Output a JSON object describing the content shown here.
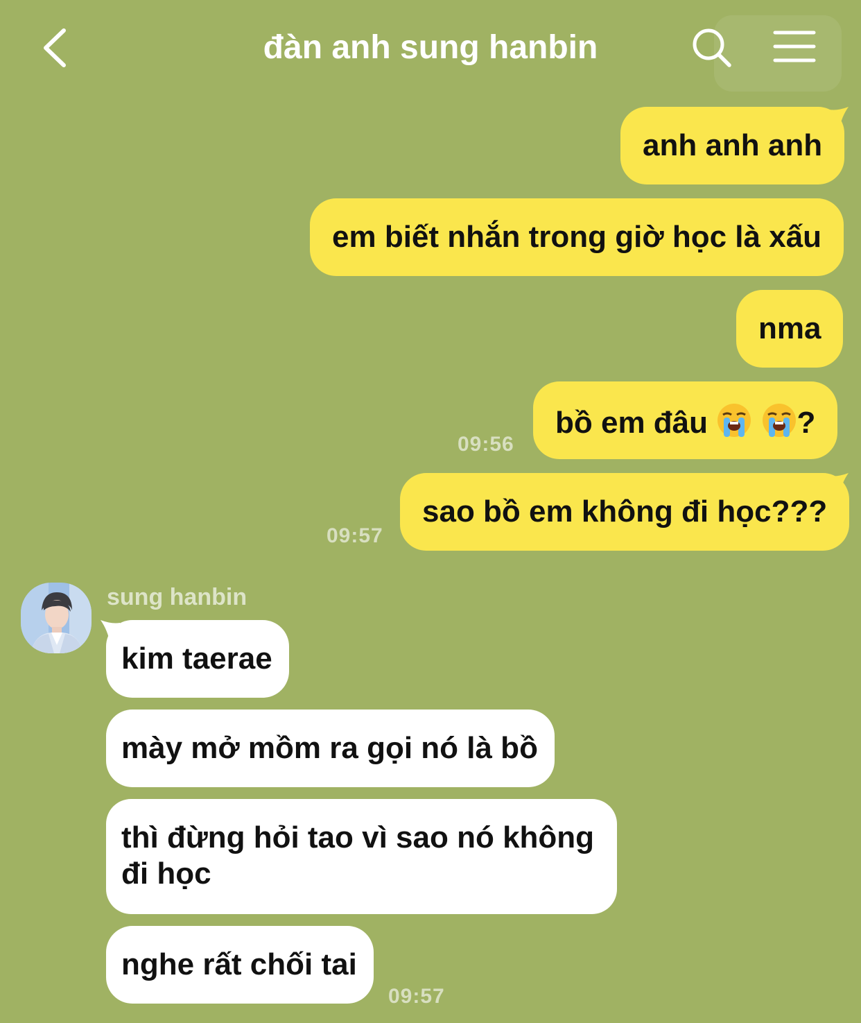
{
  "header": {
    "title": "đàn anh sung hanbin",
    "back_icon": "chevron-left-icon",
    "search_icon": "search-icon",
    "menu_icon": "hamburger-menu-icon"
  },
  "colors": {
    "background": "#a0b263",
    "outgoing_bubble": "#fae64d",
    "incoming_bubble": "#ffffff"
  },
  "messages_out": [
    {
      "text": "anh anh anh"
    },
    {
      "text": "em biết nhắn trong giờ học là xấu"
    },
    {
      "text": "nma"
    },
    {
      "text_before": "bồ em đâu",
      "emoji": "loudly-crying-face",
      "text_after": "?",
      "time": "09:56"
    },
    {
      "text": "sao bồ em không đi học???",
      "time": "09:57"
    }
  ],
  "incoming": {
    "sender": "sung hanbin",
    "avatar": "avatar",
    "messages": [
      {
        "text": "kim taerae"
      },
      {
        "text": "mày mở mồm ra gọi nó là bồ"
      },
      {
        "line1": "thì đừng hỏi tao vì sao nó không",
        "line2": "đi học"
      },
      {
        "text": "nghe rất chối tai",
        "time": "09:57"
      }
    ]
  }
}
